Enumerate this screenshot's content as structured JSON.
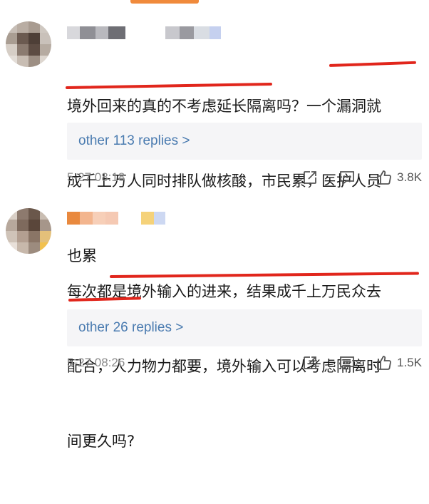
{
  "comments": [
    {
      "text": "境外回来的真的不考虑延长隔离吗？一个漏洞就成千上万人同时排队做核酸，市民累，医护人员也累",
      "line1": "境外回来的真的不考虑延长隔离吗？一个漏洞就",
      "line2": "成千上万人同时排队做核酸，市民累，医护人员",
      "line3": "也累",
      "replies_label": "other 113 replies >",
      "timestamp": "5-27 08:18",
      "likes": "3.8K"
    },
    {
      "text": "每次都是境外输入的进来，结果成千上万民众去配合，人力物力都要，境外输入可以考虑隔离时间更久吗?",
      "line1": "每次都是境外输入的进来，结果成千上万民众去",
      "line2": "配合，人力物力都要，境外输入可以考虑隔离时",
      "line3": "间更久吗?",
      "replies_label": "other 26 replies >",
      "timestamp": "5-27 08:26",
      "likes": "1.5K"
    }
  ],
  "colors": {
    "accent_indicator": "#f08a3c",
    "highlight_underline": "#e1261c",
    "link": "#4a7bb0",
    "reply_box_bg": "#f5f5f7",
    "timestamp": "#8a8a8a"
  },
  "icons": {
    "share": "share-icon",
    "reply": "comment-icon",
    "like": "thumbs-up-icon"
  }
}
